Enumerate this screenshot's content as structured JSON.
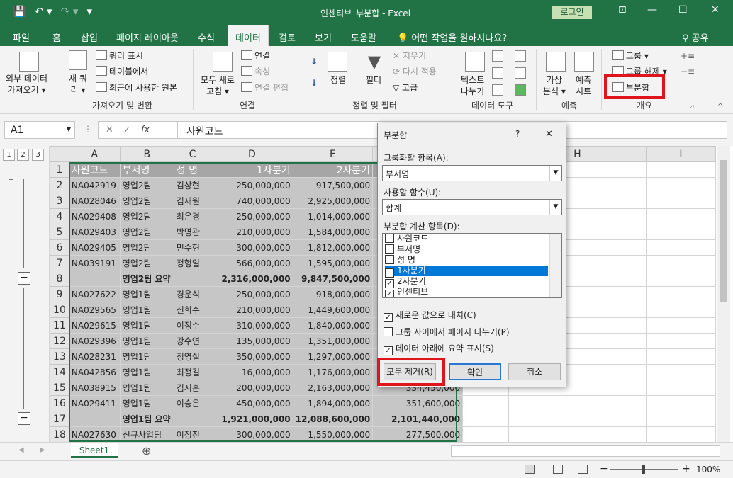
{
  "window": {
    "title": "인센티브_부분합 - Excel",
    "login": "로그인",
    "ribbon_display": "⊡",
    "minimize": "—",
    "restore": "☐",
    "close": "✕"
  },
  "qat": {
    "save": "💾",
    "undo": "↶ ▾",
    "redo": "↷ ▾",
    "customize": "▾"
  },
  "tabs": [
    "파일",
    "홈",
    "삽입",
    "페이지 레이아웃",
    "수식",
    "데이터",
    "검토",
    "보기",
    "도움말"
  ],
  "tell_me": "어떤 작업을 원하시나요?",
  "share": "공유",
  "ribbon": {
    "get_external": "외부 데이터\n가져오기 ▾",
    "new_query": "새 쿼\n리 ▾",
    "query_table": "쿼리 표시",
    "from_table": "테이블에서",
    "recent_source": "최근에 사용한 원본",
    "group_get": "가져오기 및 변환",
    "refresh_all": "모두 새로\n고침 ▾",
    "connections": "연결",
    "properties": "속성",
    "edit_links": "연결 편집",
    "group_conn": "연결",
    "sort": "정렬",
    "filter": "필터",
    "clear": "지우기",
    "reapply": "다시 적용",
    "advanced": "고급",
    "group_sort": "정렬 및 필터",
    "text_to_cols": "텍스트\n나누기",
    "group_tools": "데이터 도구",
    "what_if": "가상\n분석 ▾",
    "forecast": "예측\n시트",
    "group_forecast": "예측",
    "group_btn": "그룹 ▾",
    "ungroup": "그룹 해제 ▾",
    "subtotal": "부분합",
    "group_outline": "개요",
    "sort_az": "↓",
    "sort_za": "↓",
    "launcher": "⊿"
  },
  "formula_bar": {
    "name_box": "A1",
    "formula": "사원코드",
    "fx": "fx"
  },
  "outline_levels": [
    "1",
    "2",
    "3"
  ],
  "columns": [
    "A",
    "B",
    "C",
    "D",
    "E",
    "F",
    "G",
    "H",
    "I"
  ],
  "rows": [
    {
      "n": "1",
      "a": "사원코드",
      "b": "부서명",
      "c": "성  명",
      "d": "1사분기",
      "e": "2사분기",
      "f": "인",
      "hdr": true
    },
    {
      "n": "2",
      "a": "NA042919",
      "b": "영업2팀",
      "c": "김상현",
      "d": "250,000,000",
      "e": "917,500,000",
      "f": ""
    },
    {
      "n": "3",
      "a": "NA028046",
      "b": "영업2팀",
      "c": "김재원",
      "d": "740,000,000",
      "e": "2,925,000,000",
      "f": ""
    },
    {
      "n": "4",
      "a": "NA029408",
      "b": "영업2팀",
      "c": "최은경",
      "d": "250,000,000",
      "e": "1,014,000,000",
      "f": ""
    },
    {
      "n": "5",
      "a": "NA029403",
      "b": "영업2팀",
      "c": "박명관",
      "d": "210,000,000",
      "e": "1,584,000,000",
      "f": ""
    },
    {
      "n": "6",
      "a": "NA029405",
      "b": "영업2팀",
      "c": "민수현",
      "d": "300,000,000",
      "e": "1,812,000,000",
      "f": ""
    },
    {
      "n": "7",
      "a": "NA039191",
      "b": "영업2팀",
      "c": "정형일",
      "d": "566,000,000",
      "e": "1,595,000,000",
      "f": ""
    },
    {
      "n": "8",
      "a": "",
      "b": "영업2팀 요약",
      "c": "",
      "d": "2,316,000,000",
      "e": "9,847,500,000",
      "f": "",
      "sum": true
    },
    {
      "n": "9",
      "a": "NA027622",
      "b": "영업1팀",
      "c": "경운식",
      "d": "250,000,000",
      "e": "918,000,000",
      "f": ""
    },
    {
      "n": "10",
      "a": "NA029565",
      "b": "영업1팀",
      "c": "신희수",
      "d": "210,000,000",
      "e": "1,449,600,000",
      "f": ""
    },
    {
      "n": "11",
      "a": "NA029615",
      "b": "영업1팀",
      "c": "이정수",
      "d": "310,000,000",
      "e": "1,840,000,000",
      "f": ""
    },
    {
      "n": "12",
      "a": "NA029396",
      "b": "영업1팀",
      "c": "강수연",
      "d": "135,000,000",
      "e": "1,351,000,000",
      "f": ""
    },
    {
      "n": "13",
      "a": "NA028231",
      "b": "영업1팀",
      "c": "정영실",
      "d": "350,000,000",
      "e": "1,297,000,000",
      "f": ""
    },
    {
      "n": "14",
      "a": "NA042856",
      "b": "영업1팀",
      "c": "최정길",
      "d": "16,000,000",
      "e": "1,176,000,000",
      "f": ""
    },
    {
      "n": "15",
      "a": "NA038915",
      "b": "영업1팀",
      "c": "김지훈",
      "d": "200,000,000",
      "e": "2,163,000,000",
      "f": "334,450,000"
    },
    {
      "n": "16",
      "a": "NA029411",
      "b": "영업1팀",
      "c": "이승은",
      "d": "450,000,000",
      "e": "1,894,000,000",
      "f": "351,600,000"
    },
    {
      "n": "17",
      "a": "",
      "b": "영업1팀 요약",
      "c": "",
      "d": "1,921,000,000",
      "e": "12,088,600,000",
      "f": "2,101,440,000",
      "sum": true
    },
    {
      "n": "18",
      "a": "NA027630",
      "b": "신규사업팀",
      "c": "이정진",
      "d": "300,000,000",
      "e": "1,550,000,000",
      "f": "277,500,000"
    }
  ],
  "sheet_tab": "Sheet1",
  "add_sheet": "⊕",
  "zoom": "100%",
  "zoom_minus": "−",
  "zoom_plus": "+",
  "dialog": {
    "title": "부분합",
    "help": "?",
    "close": "✕",
    "group_by_label": "그룹화할 항목(A):",
    "group_by_value": "부서명",
    "function_label": "사용할 함수(U):",
    "function_value": "합계",
    "fields_label": "부분합 계산 항목(D):",
    "fields": [
      {
        "label": "사원코드",
        "checked": false
      },
      {
        "label": "부서명",
        "checked": false
      },
      {
        "label": "성  명",
        "checked": false
      },
      {
        "label": "1사분기",
        "checked": true
      },
      {
        "label": "2사분기",
        "checked": true
      },
      {
        "label": "인센티브",
        "checked": true
      }
    ],
    "replace": "새로운 값으로 대치(C)",
    "page_break": "그룹 사이에서 페이지 나누기(P)",
    "summary_below": "데이터 아래에 요약 표시(S)",
    "remove_all": "모두 제거(R)",
    "ok": "확인",
    "cancel": "취소",
    "check": "✓"
  }
}
